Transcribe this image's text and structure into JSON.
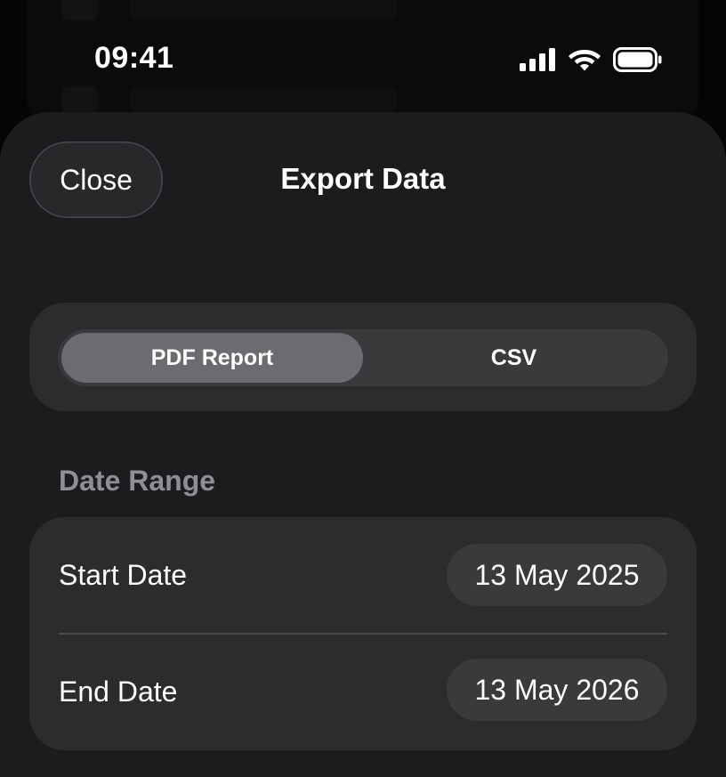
{
  "status_bar": {
    "time": "09:41",
    "icons": [
      "cellular-signal-icon",
      "wifi-icon",
      "battery-icon"
    ]
  },
  "sheet": {
    "close_label": "Close",
    "title": "Export Data"
  },
  "format_picker": {
    "options": [
      {
        "label": "PDF Report",
        "selected": true
      },
      {
        "label": "CSV",
        "selected": false
      }
    ]
  },
  "date_range": {
    "header": "Date Range",
    "rows": [
      {
        "label": "Start Date",
        "value": "13 May 2025"
      },
      {
        "label": "End Date",
        "value": "13 May 2026"
      }
    ]
  },
  "colors": {
    "sheet_background": "#1c1c1e",
    "card_background": "#2c2c2e",
    "selected_segment": "#6c6c70",
    "secondary_text": "#8e8e93"
  }
}
